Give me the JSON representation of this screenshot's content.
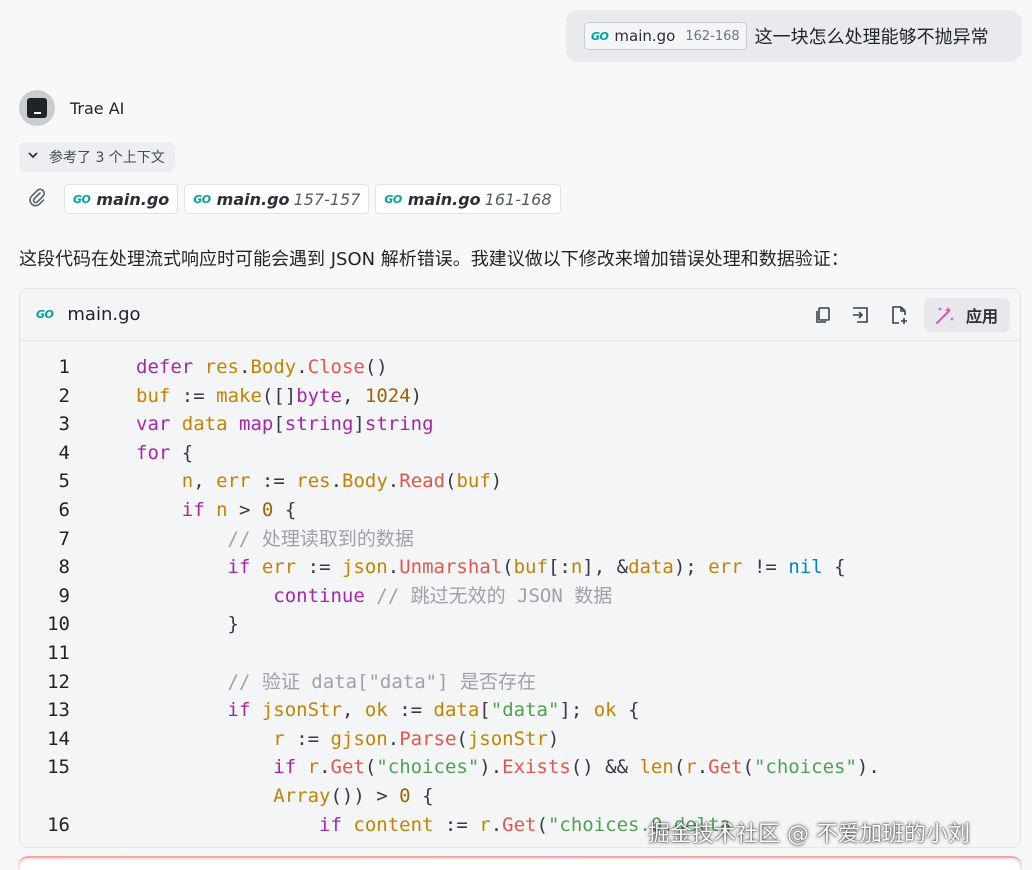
{
  "user_message": {
    "file_chip": {
      "icon": "go-icon",
      "file": "main.go",
      "range": "162-168"
    },
    "text": "这一块怎么处理能够不抛异常"
  },
  "assistant": {
    "name": "Trae AI",
    "references_toggle": "参考了 3 个上下文",
    "attached_files": [
      {
        "file": "main.go",
        "range": ""
      },
      {
        "file": "main.go",
        "range": "157-157"
      },
      {
        "file": "main.go",
        "range": "161-168"
      }
    ],
    "paragraph": "这段代码在处理流式响应时可能会遇到 JSON 解析错误。我建议做以下修改来增加错误处理和数据验证："
  },
  "code_block": {
    "filename": "main.go",
    "apply_label": "应用",
    "toolbar_icons": [
      "copy-icon",
      "insert-icon",
      "new-file-icon",
      "apply-wand-icon"
    ],
    "line_numbers": [
      "1",
      "2",
      "3",
      "4",
      "5",
      "6",
      "7",
      "8",
      "9",
      "10",
      "11",
      "12",
      "13",
      "14",
      "15",
      "",
      "16"
    ],
    "lines": [
      "defer res.Body.Close()",
      "buf := make([]byte, 1024)",
      "var data map[string]string",
      "for {",
      "    n, err := res.Body.Read(buf)",
      "    if n > 0 {",
      "        // 处理读取到的数据",
      "        if err := json.Unmarshal(buf[:n], &data); err != nil {",
      "            continue // 跳过无效的 JSON 数据",
      "        }",
      "",
      "        // 验证 data[\"data\"] 是否存在",
      "        if jsonStr, ok := data[\"data\"]; ok {",
      "            r := gjson.Parse(jsonStr)",
      "            if r.Get(\"choices\").Exists() && len(r.Get(\"choices\").",
      "            Array()) > 0 {",
      "                if content := r.Get(\"choices.0.delta"
    ]
  },
  "watermark": "掘金技术社区 @ 不爱加班的小刘",
  "colors": {
    "keyword": "#a626a4",
    "variable": "#c18401",
    "package": "#4078f2",
    "method": "#e45649",
    "number": "#986801",
    "string": "#50a14f",
    "comment": "#a0a1a7",
    "go_logo": "#00a29c"
  }
}
